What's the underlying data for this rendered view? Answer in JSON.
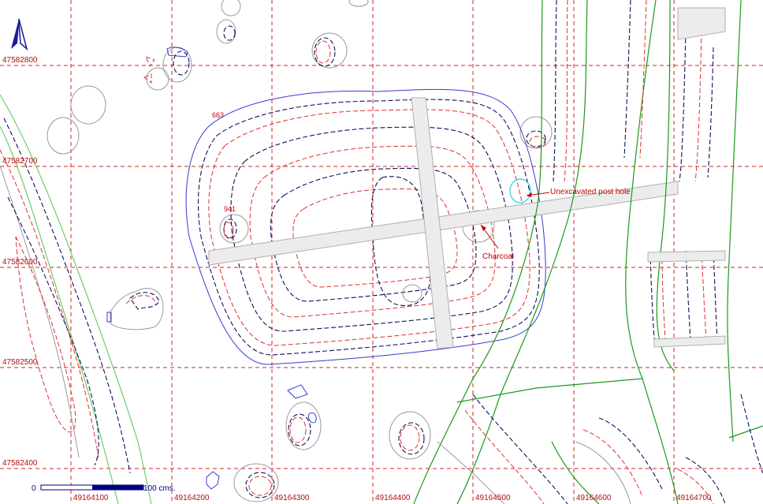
{
  "map": {
    "north_arrow": "north-arrow",
    "grid": {
      "x_labels": [
        "49164100",
        "49164200",
        "49164300",
        "49164400",
        "49164500",
        "49164600",
        "49164700"
      ],
      "y_labels": [
        "47582800",
        "47582700",
        "47582600",
        "47582500",
        "47582400"
      ]
    },
    "feature_labels": {
      "feature_663": "663",
      "feature_941": "941",
      "post_hole": "Unexcavated post hole",
      "charcoal": "Charcoal"
    },
    "scale_bar": {
      "start_label": "0",
      "end_label": "100  cms."
    },
    "colors": {
      "grid": "#d42020",
      "contour_red": "#e03030",
      "contour_navy": "#101060",
      "outline_blue": "#3a3ad0",
      "green_line": "#1a9a1a",
      "post_hole": "#20d0e0"
    }
  }
}
